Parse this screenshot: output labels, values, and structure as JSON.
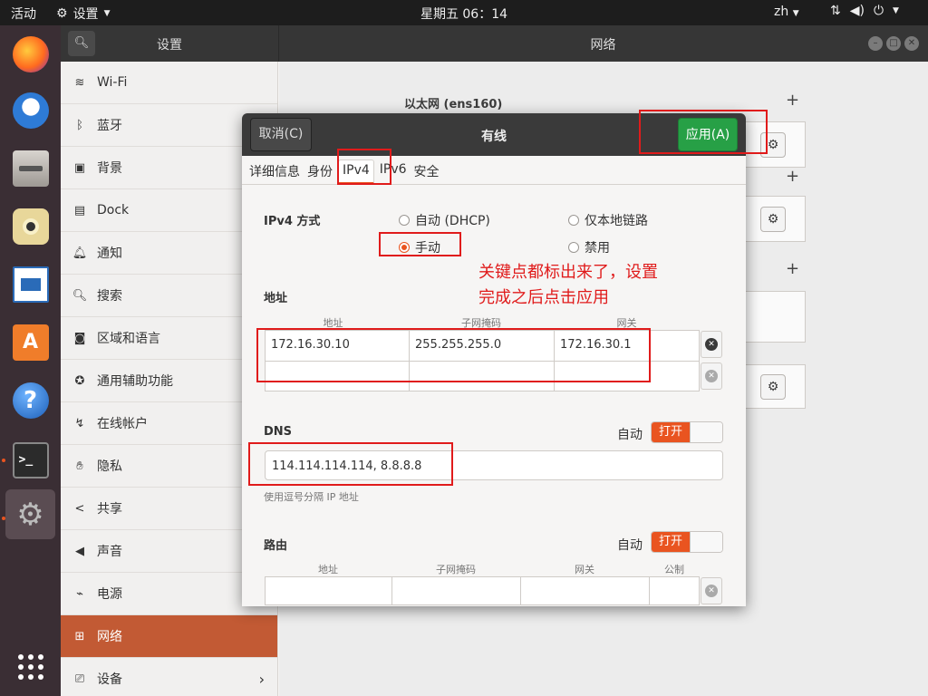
{
  "topbar": {
    "activities": "活动",
    "app_name": "设置",
    "clock": "星期五 06：14",
    "lang": "zh",
    "tray_icons": [
      "network-icon",
      "volume-icon",
      "power-icon"
    ]
  },
  "dock": {
    "items": [
      "firefox-icon",
      "thunderbird-icon",
      "files-icon",
      "rhythmbox-icon",
      "writer-icon",
      "software-icon",
      "help-icon",
      "terminal-icon",
      "settings-icon",
      "app-grid-icon"
    ]
  },
  "window": {
    "sidebar_title": "设置",
    "main_title": "网络",
    "sidebar": [
      {
        "label": "Wi-Fi",
        "icon": "wifi-icon"
      },
      {
        "label": "蓝牙",
        "icon": "bluetooth-icon"
      },
      {
        "label": "背景",
        "icon": "background-icon"
      },
      {
        "label": "Dock",
        "icon": "dock-icon"
      },
      {
        "label": "通知",
        "icon": "bell-icon"
      },
      {
        "label": "搜索",
        "icon": "search-icon"
      },
      {
        "label": "区域和语言",
        "icon": "region-icon"
      },
      {
        "label": "通用辅助功能",
        "icon": "accessibility-icon"
      },
      {
        "label": "在线帐户",
        "icon": "online-accounts-icon"
      },
      {
        "label": "隐私",
        "icon": "privacy-hand-icon"
      },
      {
        "label": "共享",
        "icon": "share-icon"
      },
      {
        "label": "声音",
        "icon": "speaker-icon"
      },
      {
        "label": "电源",
        "icon": "power-plug-icon"
      },
      {
        "label": "网络",
        "icon": "network-icon"
      },
      {
        "label": "设备",
        "icon": "devices-icon"
      }
    ],
    "active_sidebar_index": 13,
    "ethernet_title": "以太网 (ens160)"
  },
  "dialog": {
    "cancel": "取消(C)",
    "title": "有线",
    "apply": "应用(A)",
    "tabs": [
      "详细信息",
      "身份",
      "IPv4",
      "IPv6",
      "安全"
    ],
    "active_tab": "IPv4",
    "ipv4_method_label": "IPv4 方式",
    "methods": {
      "auto": "自动 (DHCP)",
      "link_local": "仅本地链路",
      "manual": "手动",
      "disabled": "禁用"
    },
    "selected_method": "manual",
    "address_section": "地址",
    "address_headers": [
      "地址",
      "子网掩码",
      "网关"
    ],
    "address_rows": [
      [
        "172.16.30.10",
        "255.255.255.0",
        "172.16.30.1"
      ],
      [
        "",
        "",
        ""
      ]
    ],
    "dns_label": "DNS",
    "dns_auto_label": "自动",
    "dns_switch": "打开",
    "dns_value": "114.114.114.114, 8.8.8.8",
    "dns_hint": "使用逗号分隔 IP 地址",
    "routes_label": "路由",
    "routes_auto_label": "自动",
    "routes_switch": "打开",
    "route_headers": [
      "地址",
      "子网掩码",
      "网关",
      "公制"
    ]
  },
  "annotation": {
    "line1": "关键点都标出来了，设置",
    "line2": "完成之后点击应用"
  },
  "colors": {
    "accent": "#e95420",
    "apply_green": "#27a046",
    "annotation_red": "#e01b1b",
    "sidebar_active": "#c25a34"
  }
}
